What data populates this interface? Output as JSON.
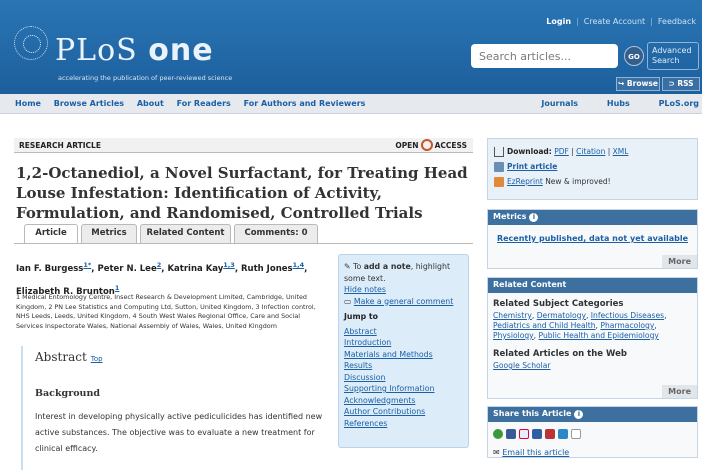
{
  "header": {
    "login": "Login",
    "create_account": "Create Account",
    "feedback": "Feedback",
    "logo_plos": "PLoS",
    "logo_one": "one",
    "tagline": "accelerating the publication of peer-reviewed science",
    "search_placeholder": "Search articles...",
    "go": "GO",
    "advanced_search": "Advanced Search",
    "browse": "Browse",
    "rss": "RSS"
  },
  "nav": {
    "left": [
      "Home",
      "Browse Articles",
      "About",
      "For Readers",
      "For Authors and Reviewers"
    ],
    "right": [
      "Journals",
      "Hubs",
      "PLoS.org"
    ]
  },
  "article": {
    "type": "RESEARCH ARTICLE",
    "open": "OPEN",
    "access": "ACCESS",
    "title": "1,2-Octanediol, a Novel Surfactant, for Treating Head Louse Infestation: Identification of Activity, Formulation, and Randomised, Controlled Trials",
    "tabs": [
      "Article",
      "Metrics",
      "Related Content",
      "Comments: 0"
    ],
    "authors": [
      {
        "name": "Ian F. Burgess",
        "sup": "1*"
      },
      {
        "name": "Peter N. Lee",
        "sup": "2"
      },
      {
        "name": "Katrina Kay",
        "sup": "1,3"
      },
      {
        "name": "Ruth Jones",
        "sup": "1,4"
      },
      {
        "name": "Elizabeth R. Brunton",
        "sup": "1"
      }
    ],
    "affiliations": "1 Medical Entomology Centre, Insect Research & Development Limited, Cambridge, United Kingdom, 2 PN Lee Statistics and Computing Ltd, Sutton, United Kingdom, 3 Infection control, NHS Leeds, Leeds, United Kingdom, 4 South West Wales Regional Office, Care and Social Services Inspectorate Wales, National Assembly of Wales, Wales, United Kingdom",
    "abstract_heading": "Abstract",
    "top_link": "Top",
    "background_heading": "Background",
    "abstract_text": "Interest in developing physically active pediculicides has identified new active substances. The objective was to evaluate a new treatment for clinical efficacy."
  },
  "notes": {
    "to": "To ",
    "add_note": "add a note",
    "rest": ", highlight some text.",
    "hide_notes": "Hide notes",
    "general_comment": "Make a general comment"
  },
  "jump": {
    "title": "Jump to",
    "links": [
      "Abstract",
      "Introduction",
      "Materials and Methods",
      "Results",
      "Discussion",
      "Supporting Information",
      "Acknowledgments",
      "Author Contributions",
      "References"
    ]
  },
  "sidebar": {
    "download_label": "Download:",
    "pdf": "PDF",
    "citation": "Citation",
    "xml": "XML",
    "print": "Print article",
    "ezreprint": "EzReprint",
    "ezreprint_note": "New & improved!",
    "metrics_title": "Metrics",
    "metrics_link": "Recently published, data not yet available",
    "more": "More",
    "related_title": "Related Content",
    "related_sub": "Related Subject Categories",
    "categories": [
      "Chemistry",
      "Dermatology",
      "Infectious Diseases",
      "Pediatrics and Child Health",
      "Pharmacology",
      "Physiology",
      "Public Health and Epidemiology"
    ],
    "web_sub": "Related Articles on the Web",
    "google": "Google Scholar",
    "share_title": "Share this Article",
    "email": "Email this article"
  },
  "colors": {
    "header_blue": "#2a75b4",
    "link_blue": "#1b5fa6",
    "sidebar_header": "#3d6f9f",
    "jump_bg": "#dcecf8"
  }
}
